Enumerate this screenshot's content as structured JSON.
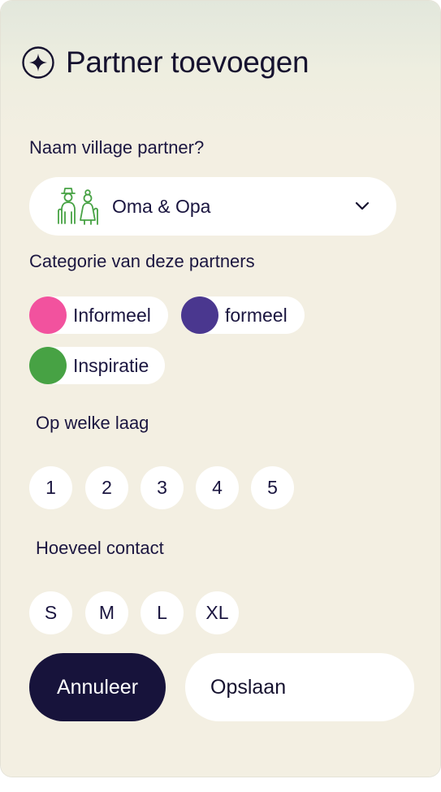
{
  "header": {
    "title": "Partner toevoegen",
    "icon": "sparkle-icon"
  },
  "partner_name": {
    "label": "Naam village partner?",
    "selected_value": "Oma & Opa",
    "icon": "grandparents-icon"
  },
  "category": {
    "label": "Categorie van deze partners",
    "options": [
      {
        "label": "Informeel",
        "color": "#f2529e"
      },
      {
        "label": "formeel",
        "color": "#4a378f"
      },
      {
        "label": "Inspiratie",
        "color": "#47a244"
      }
    ]
  },
  "layer": {
    "label": "Op welke laag",
    "options": [
      "1",
      "2",
      "3",
      "4",
      "5"
    ]
  },
  "contact": {
    "label": "Hoeveel contact",
    "options": [
      "S",
      "M",
      "L",
      "XL"
    ]
  },
  "actions": {
    "cancel_label": "Annuleer",
    "save_label": "Opslaan"
  },
  "colors": {
    "primary_dark": "#17133b",
    "text": "#1b1640",
    "panel_background": "#f3efe2",
    "icon_green": "#47a244"
  }
}
